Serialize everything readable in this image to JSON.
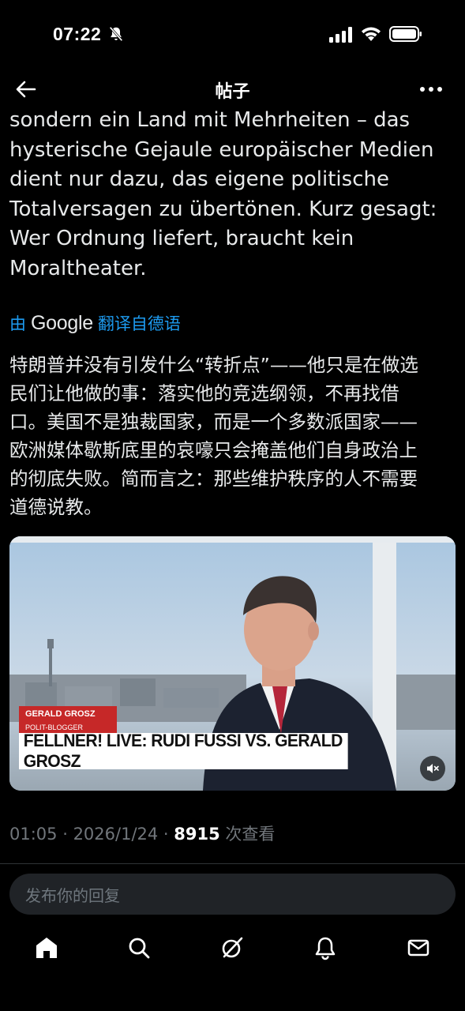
{
  "status_bar": {
    "time": "07:22",
    "icons": [
      "bell-slash-icon",
      "signal-icon",
      "wifi-icon",
      "battery-icon"
    ]
  },
  "header": {
    "title": "帖子",
    "back_icon": "back-arrow-icon",
    "more_icon": "more-icon"
  },
  "post": {
    "text_lines": [
      "sondern ein Land mit Mehrheiten – das",
      "hysterische Gejaule europäischer Medien",
      "dient nur dazu, das eigene politische",
      "Totalversagen zu übertönen. Kurz gesagt:",
      "Wer Ordnung liefert, braucht kein",
      "Moraltheater."
    ],
    "translate_prefix": "由",
    "translate_brand": "Google",
    "translate_suffix": "翻译自德语",
    "translated_lines": [
      "特朗普并没有引发什么“转折点”——他只是在做选",
      "民们让他做的事：落实他的竞选纲领，不再找借",
      "口。美国不是独裁国家，而是一个多数派国家——",
      "欧洲媒体歇斯底里的哀嚎只会掩盖他们自身政治上",
      "的彻底失败。简而言之：那些维护秩序的人不需要",
      "道德说教。"
    ]
  },
  "video": {
    "name_tag_name": "GERALD GROSZ",
    "name_tag_role": "POLIT-BLOGGER",
    "lower_third": "FELLNER! LIVE: RUDI FUSSI VS. GERALD GROSZ",
    "mute_icon": "muted-speaker-icon"
  },
  "meta": {
    "time": "01:05",
    "sep1": " · ",
    "date": "2026/1/24",
    "sep2": " · ",
    "views": "8915",
    "views_label": " 次查看"
  },
  "reply": {
    "placeholder": "发布你的回复"
  },
  "bottom_nav": {
    "items": [
      "home-icon",
      "search-icon",
      "grok-icon",
      "notifications-icon",
      "messages-icon"
    ]
  },
  "colors": {
    "background": "#000000",
    "text": "#e7e9ea",
    "link_blue": "#1d9bf0",
    "muted": "#71767b",
    "tag_red": "#c62828"
  }
}
